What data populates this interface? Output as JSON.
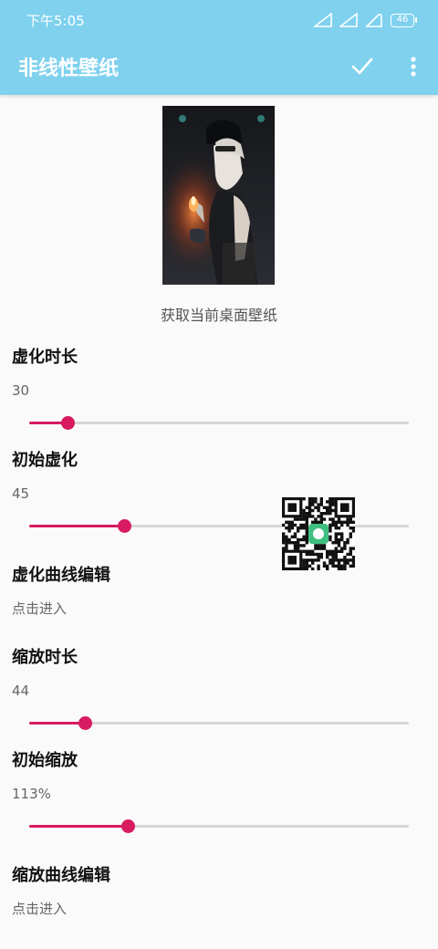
{
  "status_bar": {
    "time": "下午5:05",
    "battery": "46",
    "icons": [
      "signal-icon",
      "signal-icon",
      "wifi-icon",
      "battery-icon"
    ]
  },
  "app_bar": {
    "title": "非线性壁纸",
    "actions": [
      "check-icon",
      "more-vert-icon"
    ],
    "color": "#7fd1ee"
  },
  "wallpaper": {
    "action_label": "获取当前桌面壁纸"
  },
  "accent_color": "#d81b60",
  "settings": {
    "blur_duration": {
      "title": "虚化时长",
      "value": "30",
      "slider_fraction": 0.1
    },
    "initial_blur": {
      "title": "初始虚化",
      "value": "45",
      "slider_fraction": 0.25
    },
    "blur_curve": {
      "title": "虚化曲线编辑",
      "summary": "点击进入"
    },
    "scale_duration": {
      "title": "缩放时长",
      "value": "44",
      "slider_fraction": 0.147
    },
    "initial_scale": {
      "title": "初始缩放",
      "value": "113%",
      "slider_fraction": 0.26
    },
    "scale_curve": {
      "title": "缩放曲线编辑",
      "summary": "点击进入"
    }
  }
}
